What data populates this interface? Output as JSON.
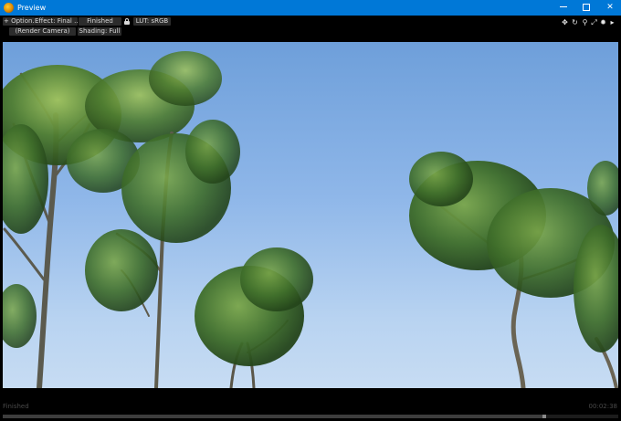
{
  "window": {
    "title": "Preview"
  },
  "toolbar": {
    "options_label": "+ Option...",
    "effect_label": "Effect: Final ...",
    "status_label": "Finished",
    "lut_label": "LUT: sRGB",
    "camera_label": "(Render Camera)",
    "shading_label": "Shading: Full"
  },
  "viewport_icons": [
    "move-icon",
    "rotate-icon",
    "zoom-icon",
    "fit-icon",
    "gear-icon",
    "play-icon"
  ],
  "footer": {
    "status_text": "Finished",
    "time_text": "00:02:38",
    "progress": 0.88
  },
  "colors": {
    "titlebar": "#0078d7",
    "sky_top": "#6e9fda",
    "sky_bottom": "#c7dcf3",
    "foliage": "#3f6e2a"
  }
}
